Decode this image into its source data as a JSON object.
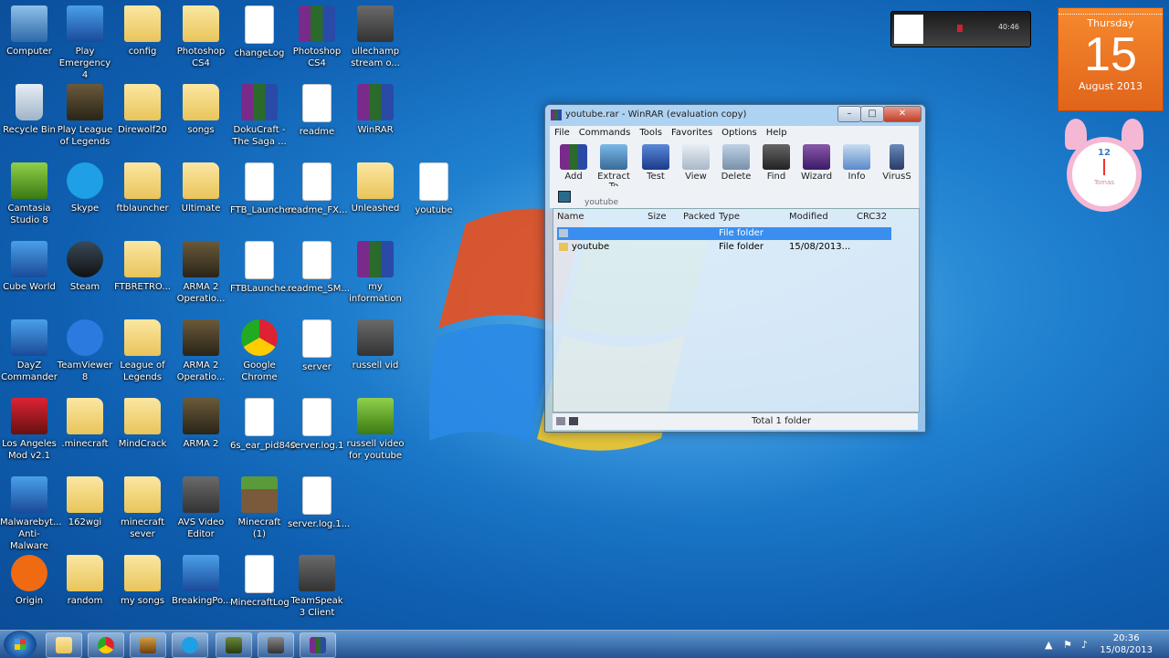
{
  "desktop_icons": [
    {
      "label": "Computer",
      "col": 0,
      "row": 0,
      "kind": "pc"
    },
    {
      "label": "Play Emergency 4",
      "col": 1,
      "row": 0,
      "kind": "blue"
    },
    {
      "label": "config",
      "col": 2,
      "row": 0,
      "kind": "folder"
    },
    {
      "label": "Photoshop CS4",
      "col": 3,
      "row": 0,
      "kind": "folder"
    },
    {
      "label": "changeLog",
      "col": 4,
      "row": 0,
      "kind": "file"
    },
    {
      "label": "Photoshop CS4",
      "col": 5,
      "row": 0,
      "kind": "rar"
    },
    {
      "label": "ullechamp stream o...",
      "col": 6,
      "row": 0,
      "kind": "app"
    },
    {
      "label": "Recycle Bin",
      "col": 0,
      "row": 1,
      "kind": "bin"
    },
    {
      "label": "Play League of Legends",
      "col": 1,
      "row": 1,
      "kind": "arma"
    },
    {
      "label": "Direwolf20",
      "col": 2,
      "row": 1,
      "kind": "folder"
    },
    {
      "label": "songs",
      "col": 3,
      "row": 1,
      "kind": "folder"
    },
    {
      "label": "DokuCraft - The Saga ...",
      "col": 4,
      "row": 1,
      "kind": "rar"
    },
    {
      "label": "readme",
      "col": 5,
      "row": 1,
      "kind": "file"
    },
    {
      "label": "WinRAR",
      "col": 6,
      "row": 1,
      "kind": "rar"
    },
    {
      "label": "Camtasia Studio 8",
      "col": 0,
      "row": 2,
      "kind": "green"
    },
    {
      "label": "Skype",
      "col": 1,
      "row": 2,
      "kind": "skype"
    },
    {
      "label": "ftblauncher",
      "col": 2,
      "row": 2,
      "kind": "folder"
    },
    {
      "label": "Ultimate",
      "col": 3,
      "row": 2,
      "kind": "folder"
    },
    {
      "label": "FTB_Launcher",
      "col": 4,
      "row": 2,
      "kind": "file"
    },
    {
      "label": "readme_FX...",
      "col": 5,
      "row": 2,
      "kind": "file"
    },
    {
      "label": "Unleashed",
      "col": 6,
      "row": 2,
      "kind": "folder"
    },
    {
      "label": "youtube",
      "col": 7,
      "row": 2,
      "kind": "file"
    },
    {
      "label": "Cube World",
      "col": 0,
      "row": 3,
      "kind": "blue"
    },
    {
      "label": "Steam",
      "col": 1,
      "row": 3,
      "kind": "steam"
    },
    {
      "label": "FTBRETRO...",
      "col": 2,
      "row": 3,
      "kind": "folder"
    },
    {
      "label": "ARMA 2 Operatio...",
      "col": 3,
      "row": 3,
      "kind": "arma"
    },
    {
      "label": "FTBLaunche...",
      "col": 4,
      "row": 3,
      "kind": "file"
    },
    {
      "label": "readme_SM...",
      "col": 5,
      "row": 3,
      "kind": "file"
    },
    {
      "label": "my information",
      "col": 6,
      "row": 3,
      "kind": "rar"
    },
    {
      "label": "DayZ Commander",
      "col": 0,
      "row": 4,
      "kind": "blue"
    },
    {
      "label": "TeamViewer 8",
      "col": 1,
      "row": 4,
      "kind": "team"
    },
    {
      "label": "League of Legends",
      "col": 2,
      "row": 4,
      "kind": "folder"
    },
    {
      "label": "ARMA 2 Operatio...",
      "col": 3,
      "row": 4,
      "kind": "arma"
    },
    {
      "label": "Google Chrome",
      "col": 4,
      "row": 4,
      "kind": "chrome"
    },
    {
      "label": "server",
      "col": 5,
      "row": 4,
      "kind": "file"
    },
    {
      "label": "russell vid",
      "col": 6,
      "row": 4,
      "kind": "app"
    },
    {
      "label": "Los Angeles Mod v2.1",
      "col": 0,
      "row": 5,
      "kind": "red"
    },
    {
      "label": ".minecraft",
      "col": 1,
      "row": 5,
      "kind": "folder"
    },
    {
      "label": "MindCrack",
      "col": 2,
      "row": 5,
      "kind": "folder"
    },
    {
      "label": "ARMA 2",
      "col": 3,
      "row": 5,
      "kind": "arma"
    },
    {
      "label": "6s_ear_pid840",
      "col": 4,
      "row": 5,
      "kind": "file"
    },
    {
      "label": "server.log.1",
      "col": 5,
      "row": 5,
      "kind": "file"
    },
    {
      "label": "russell video for youtube",
      "col": 6,
      "row": 5,
      "kind": "green"
    },
    {
      "label": "Malwarebyt... Anti-Malware",
      "col": 0,
      "row": 6,
      "kind": "blue"
    },
    {
      "label": "162wgi",
      "col": 1,
      "row": 6,
      "kind": "folder"
    },
    {
      "label": "minecraft sever",
      "col": 2,
      "row": 6,
      "kind": "folder"
    },
    {
      "label": "AVS Video Editor",
      "col": 3,
      "row": 6,
      "kind": "app"
    },
    {
      "label": "Minecraft (1)",
      "col": 4,
      "row": 6,
      "kind": "mc"
    },
    {
      "label": "server.log.1...",
      "col": 5,
      "row": 6,
      "kind": "file"
    },
    {
      "label": "Origin",
      "col": 0,
      "row": 7,
      "kind": "origin"
    },
    {
      "label": "random",
      "col": 1,
      "row": 7,
      "kind": "folder"
    },
    {
      "label": "my songs",
      "col": 2,
      "row": 7,
      "kind": "folder"
    },
    {
      "label": "BreakingPo...",
      "col": 3,
      "row": 7,
      "kind": "blue"
    },
    {
      "label": "MinecraftLog",
      "col": 4,
      "row": 7,
      "kind": "file"
    },
    {
      "label": "TeamSpeak 3 Client",
      "col": 5,
      "row": 7,
      "kind": "app"
    }
  ],
  "calendar": {
    "weekday": "Thursday",
    "day": "15",
    "month_year": "August 2013"
  },
  "clock_gadget": {
    "hour_label": "12",
    "caption": "Tomas"
  },
  "media_widget": {
    "time": "40:46"
  },
  "winrar": {
    "title": "youtube.rar - WinRAR (evaluation copy)",
    "menu": [
      "File",
      "Commands",
      "Tools",
      "Favorites",
      "Options",
      "Help"
    ],
    "toolbar": [
      "Add",
      "Extract To",
      "Test",
      "View",
      "Delete",
      "Find",
      "Wizard",
      "Info",
      "VirusS"
    ],
    "address": "youtube",
    "columns": [
      "Name",
      "Size",
      "Packed",
      "Type",
      "Modified",
      "CRC32"
    ],
    "rows": [
      {
        "name": "",
        "size": "",
        "packed": "",
        "type": "File folder",
        "modified": "",
        "crc": ""
      },
      {
        "name": "youtube",
        "size": "",
        "packed": "",
        "type": "File folder",
        "modified": "15/08/2013...",
        "crc": ""
      }
    ],
    "status": "Total 1 folder"
  },
  "taskbar": {
    "clock_time": "20:36",
    "clock_date": "15/08/2013",
    "buttons": [
      "explorer",
      "chrome",
      "game",
      "skype",
      "camtasia",
      "app",
      "winrar"
    ]
  },
  "colors": {
    "desktop": "#1f7fcf",
    "calendar": "#f07a26",
    "selection": "#3a8ef0"
  }
}
